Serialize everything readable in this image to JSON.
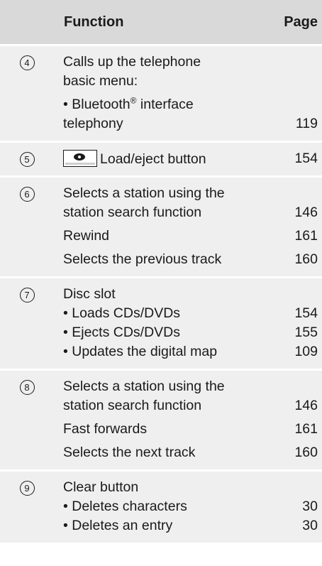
{
  "header": {
    "function_label": "Function",
    "page_label": "Page"
  },
  "rows": [
    {
      "number": "4",
      "lines": [
        {
          "text": "Calls up the telephone",
          "page": ""
        },
        {
          "text": "basic menu:",
          "page": ""
        },
        {
          "text": "• Bluetooth",
          "sup": "®",
          "text2": " interface",
          "page": ""
        },
        {
          "text": "telephony",
          "page": "119"
        }
      ]
    },
    {
      "number": "5",
      "lines": [
        {
          "icon": "disc-eject-key-icon",
          "text": "Load/eject button",
          "page": "154"
        }
      ]
    },
    {
      "number": "6",
      "lines": [
        {
          "text": "Selects a station using the",
          "page": ""
        },
        {
          "text": "station search function",
          "page": "146"
        },
        {
          "text": "Rewind",
          "page": "161"
        },
        {
          "text": "Selects the previous track",
          "page": "160"
        }
      ]
    },
    {
      "number": "7",
      "lines": [
        {
          "text": "Disc slot",
          "page": ""
        },
        {
          "text": "• Loads CDs/DVDs",
          "page": "154"
        },
        {
          "text": "• Ejects CDs/DVDs",
          "page": "155"
        },
        {
          "text": "• Updates the digital map",
          "page": "109"
        }
      ]
    },
    {
      "number": "8",
      "lines": [
        {
          "text": "Selects a station using the",
          "page": ""
        },
        {
          "text": "station search function",
          "page": "146"
        },
        {
          "text": "Fast forwards",
          "page": "161"
        },
        {
          "text": "Selects the next track",
          "page": "160"
        }
      ]
    },
    {
      "number": "9",
      "lines": [
        {
          "text": "Clear button",
          "page": ""
        },
        {
          "text": "• Deletes characters",
          "page": "30"
        },
        {
          "text": "• Deletes an entry",
          "page": "30"
        }
      ]
    }
  ]
}
